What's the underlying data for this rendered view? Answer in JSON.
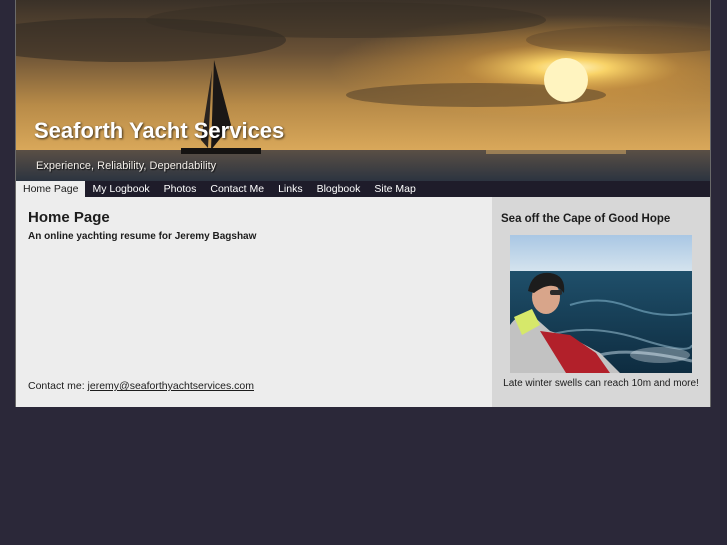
{
  "header": {
    "site_title": "Seaforth Yacht Services",
    "tagline": "Experience, Reliability, Dependability"
  },
  "nav": {
    "items": [
      {
        "label": "Home Page",
        "active": true
      },
      {
        "label": "My Logbook",
        "active": false
      },
      {
        "label": "Photos",
        "active": false
      },
      {
        "label": "Contact Me",
        "active": false
      },
      {
        "label": "Links",
        "active": false
      },
      {
        "label": "Blogbook",
        "active": false
      },
      {
        "label": "Site Map",
        "active": false
      }
    ]
  },
  "main": {
    "title": "Home Page",
    "subtitle": "An online yachting resume for Jeremy Bagshaw",
    "contact_label": "Contact me: ",
    "contact_email": "jeremy@seaforthyachtservices.com"
  },
  "sidebar": {
    "title": "Sea off the Cape of Good Hope",
    "caption": "Late winter swells can reach 10m and more!"
  },
  "colors": {
    "background": "#2b2839",
    "nav_bar": "#1e1c2a",
    "content": "#ededed",
    "sidebar": "#d7d7d7"
  }
}
